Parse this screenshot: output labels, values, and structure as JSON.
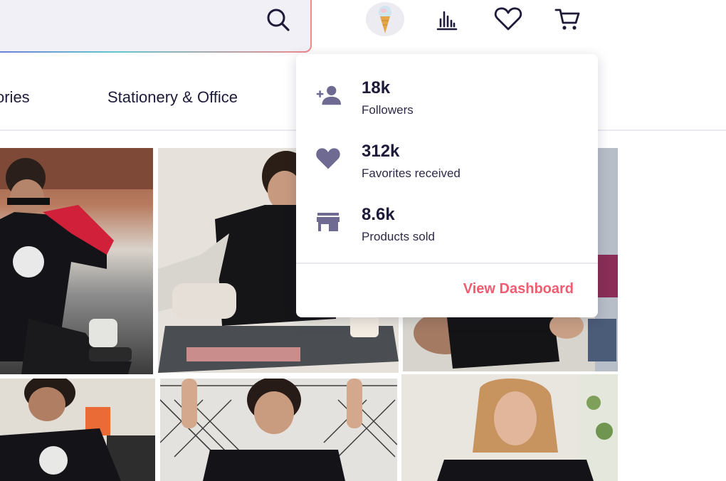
{
  "header": {
    "search": {
      "placeholder": "",
      "value": ""
    },
    "icons": [
      "avatar",
      "stats-icon",
      "heart-icon",
      "cart-icon"
    ]
  },
  "categories": [
    {
      "label": "ories"
    },
    {
      "label": "Stationery & Office"
    }
  ],
  "dropdown": {
    "stats": [
      {
        "icon": "add-person-icon",
        "value": "18k",
        "label": "Followers"
      },
      {
        "icon": "heart-icon",
        "value": "312k",
        "label": "Favorites received"
      },
      {
        "icon": "store-icon",
        "value": "8.6k",
        "label": "Products sold"
      }
    ],
    "link": "View Dashboard"
  },
  "colors": {
    "text": "#1e1b3a",
    "icon": "#6e6a91",
    "accent": "#f05c70",
    "search_bg": "#f1f0f6"
  }
}
